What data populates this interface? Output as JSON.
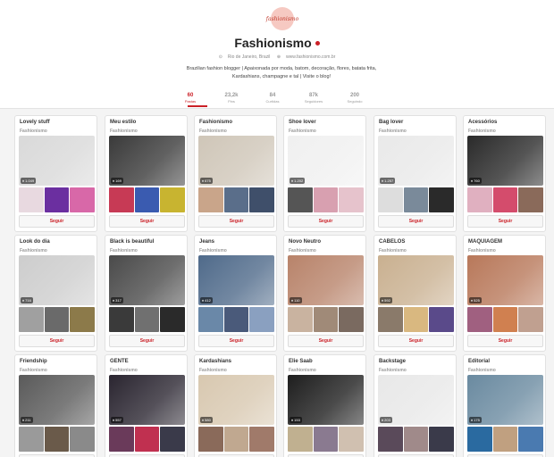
{
  "profile": {
    "avatar_text": "fashionismo",
    "name": "Fashionismo",
    "location": "Rio de Janeiro, Brazil",
    "website": "www.fashionismo.com.br",
    "bio_line1": "Brazilian fashion blogger | Apaixonada por moda, batom, decoração, flores, batata frita,",
    "bio_line2": "Kardashians, champagne e tal | Visite o blog!"
  },
  "stats": [
    {
      "value": "60",
      "label": "Pastas"
    },
    {
      "value": "23,2k",
      "label": "Pins"
    },
    {
      "value": "84",
      "label": "Curtidas"
    },
    {
      "value": "87k",
      "label": "Seguidores"
    },
    {
      "value": "200",
      "label": "Seguindo"
    }
  ],
  "follow_label": "Seguir",
  "boards": [
    {
      "title": "Lovely stuff",
      "owner": "Fashionismo",
      "pins": "1.049",
      "cover": "#d9d9d9",
      "thumbs": [
        "#e8d9e0",
        "#6b2fa0",
        "#d868a8"
      ]
    },
    {
      "title": "Meu estilo",
      "owner": "Fashionismo",
      "pins": "169",
      "cover": "#3a3a3a",
      "thumbs": [
        "#c73a55",
        "#3a5bb0",
        "#c8b430"
      ]
    },
    {
      "title": "Fashionismo",
      "owner": "Fashionismo",
      "pins": "675",
      "cover": "#cfc6b8",
      "thumbs": [
        "#c9a58a",
        "#5a6e8a",
        "#3f4f6a"
      ]
    },
    {
      "title": "Shoe lover",
      "owner": "Fashionismo",
      "pins": "1.202",
      "cover": "#f0f0f0",
      "thumbs": [
        "#555555",
        "#d8a0b0",
        "#e6c3cc"
      ]
    },
    {
      "title": "Bag lover",
      "owner": "Fashionismo",
      "pins": "1.257",
      "cover": "#e9e9e9",
      "thumbs": [
        "#dddddd",
        "#7a8a9a",
        "#2a2a2a"
      ]
    },
    {
      "title": "Acessórios",
      "owner": "Fashionismo",
      "pins": "760",
      "cover": "#2a2a2a",
      "thumbs": [
        "#e0b0c0",
        "#d44c6c",
        "#8a6a5a"
      ]
    },
    {
      "title": "Look do dia",
      "owner": "Fashionismo",
      "pins": "716",
      "cover": "#cdcdcd",
      "thumbs": [
        "#a0a0a0",
        "#6a6a6a",
        "#8c7a4a"
      ]
    },
    {
      "title": "Black is beautiful",
      "owner": "Fashionismo",
      "pins": "317",
      "cover": "#4a4a4a",
      "thumbs": [
        "#3a3a3a",
        "#707070",
        "#2a2a2a"
      ]
    },
    {
      "title": "Jeans",
      "owner": "Fashionismo",
      "pins": "412",
      "cover": "#4f6a8a",
      "thumbs": [
        "#6a88a8",
        "#4a5a7a",
        "#8aa0c0"
      ]
    },
    {
      "title": "Novo Neutro",
      "owner": "Fashionismo",
      "pins": "110",
      "cover": "#b8836a",
      "thumbs": [
        "#c9b3a0",
        "#a08a78",
        "#7a6a60"
      ]
    },
    {
      "title": "CABELOS",
      "owner": "Fashionismo",
      "pins": "592",
      "cover": "#c9b090",
      "thumbs": [
        "#8a7a6a",
        "#d9b880",
        "#5a4a8a"
      ]
    },
    {
      "title": "MAQUIAGEM",
      "owner": "Fashionismo",
      "pins": "525",
      "cover": "#b8785a",
      "thumbs": [
        "#a06080",
        "#d08050",
        "#c0a090"
      ]
    },
    {
      "title": "Friendship",
      "owner": "Fashionismo",
      "pins": "211",
      "cover": "#5a5a5a",
      "thumbs": [
        "#9a9a9a",
        "#6a5a4a",
        "#8a8a8a"
      ]
    },
    {
      "title": "GENTE",
      "owner": "Fashionismo",
      "pins": "557",
      "cover": "#2a2530",
      "thumbs": [
        "#6a3a5a",
        "#c03050",
        "#3a3a4a"
      ]
    },
    {
      "title": "Kardashians",
      "owner": "Fashionismo",
      "pins": "580",
      "cover": "#d8c8b0",
      "thumbs": [
        "#8a6a5a",
        "#c0a890",
        "#a07a6a"
      ]
    },
    {
      "title": "Elie Saab",
      "owner": "Fashionismo",
      "pins": "153",
      "cover": "#1e1e1e",
      "thumbs": [
        "#c0b090",
        "#8a7a90",
        "#d0c0b0"
      ]
    },
    {
      "title": "Backstage",
      "owner": "Fashionismo",
      "pins": "203",
      "cover": "#e8e8e8",
      "thumbs": [
        "#5a4a5a",
        "#a08a8a",
        "#3a3a4a"
      ]
    },
    {
      "title": "Editorial",
      "owner": "Fashionismo",
      "pins": "175",
      "cover": "#6a8aa0",
      "thumbs": [
        "#2a6aa0",
        "#c0a080",
        "#4a7ab0"
      ]
    }
  ]
}
